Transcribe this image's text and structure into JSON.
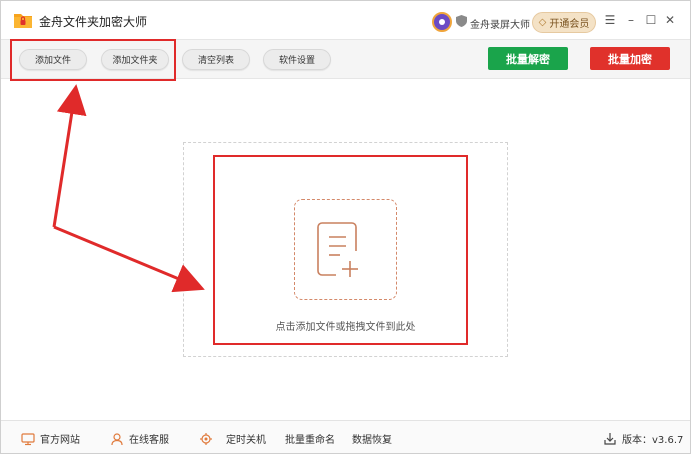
{
  "title_bar": {
    "app_title": "金舟文件夹加密大师",
    "promo_label": "金舟录屏大师",
    "vip_button_label": "开通会员",
    "menu_glyph": "☰",
    "minimize_glyph": "–",
    "maximize_glyph": "☐",
    "close_glyph": "✕"
  },
  "toolbar": {
    "add_file_label": "添加文件",
    "add_folder_label": "添加文件夹",
    "clear_list_label": "清空列表",
    "settings_label": "软件设置",
    "batch_decrypt_label": "批量解密",
    "batch_encrypt_label": "批量加密"
  },
  "drop_area": {
    "hint_text": "点击添加文件或拖拽文件到此处"
  },
  "status_bar": {
    "official_site_label": "官方网站",
    "online_service_label": "在线客服",
    "scheduled_shutdown_label": "定时关机",
    "batch_rename_label": "批量重命名",
    "data_recovery_label": "数据恢复",
    "version_label": "版本：v3.6.7"
  },
  "colors": {
    "decrypt_button": "#1aa44b",
    "encrypt_button": "#e0312b",
    "annotation_red": "#e02a2a",
    "drop_icon_accent": "#d4896a"
  },
  "icons": {
    "app_logo": "folder-lock-icon",
    "promo": "screen-recorder-icon",
    "vip": "diamond-icon",
    "drop": "add-document-icon",
    "official_site": "monitor-icon",
    "online_service": "headset-user-icon",
    "scheduled_shutdown": "gear-clock-icon",
    "version": "download-icon"
  }
}
